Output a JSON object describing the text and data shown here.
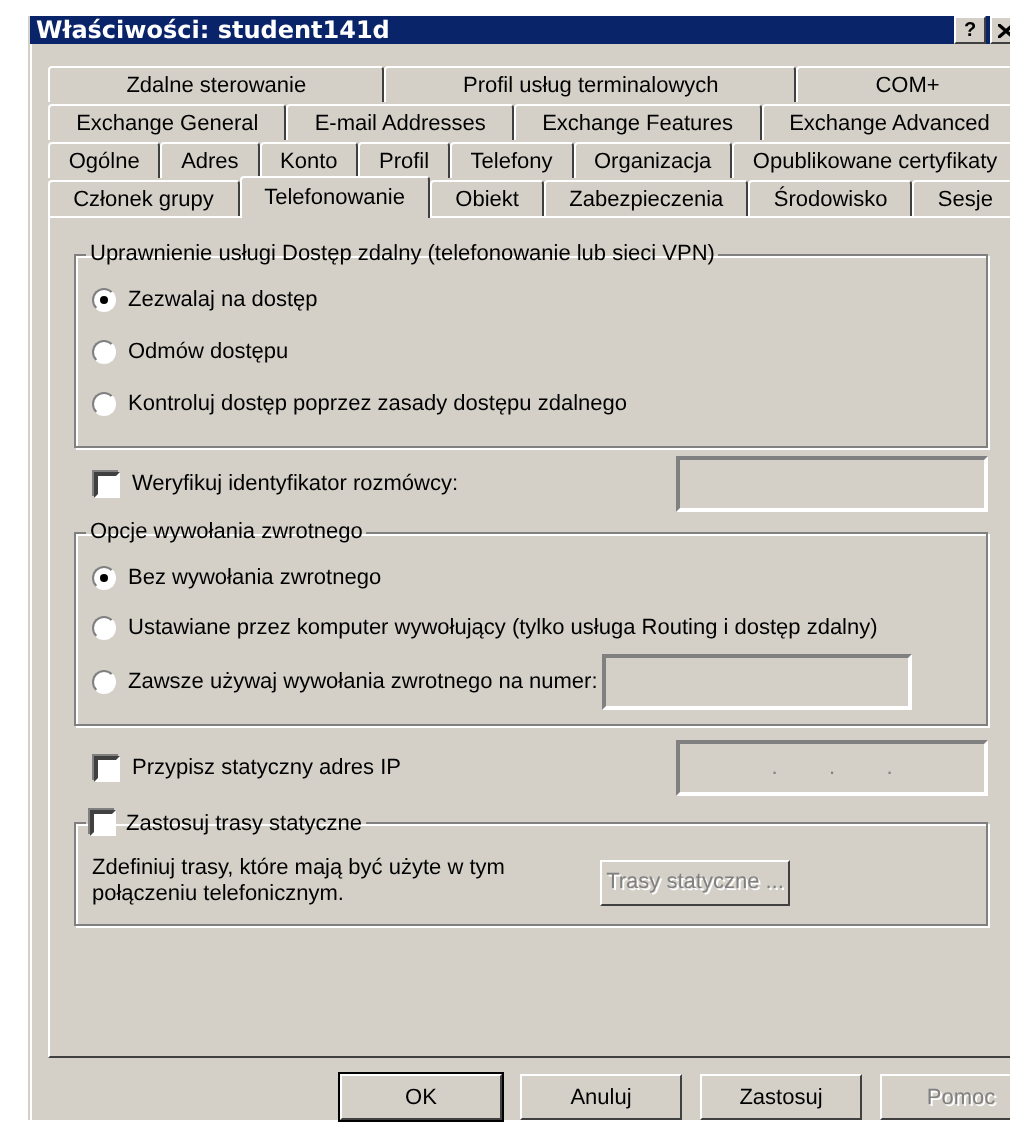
{
  "window": {
    "title": "Właściwości: student141d",
    "help_button": "?"
  },
  "tab_rows": [
    [
      {
        "label": "Zdalne sterowanie",
        "selected": false
      },
      {
        "label": "Profil usług terminalowych",
        "selected": false
      },
      {
        "label": "COM+",
        "selected": false
      }
    ],
    [
      {
        "label": "Exchange General",
        "selected": false
      },
      {
        "label": "E-mail Addresses",
        "selected": false
      },
      {
        "label": "Exchange Features",
        "selected": false
      },
      {
        "label": "Exchange Advanced",
        "selected": false
      }
    ],
    [
      {
        "label": "Ogólne",
        "selected": false
      },
      {
        "label": "Adres",
        "selected": false
      },
      {
        "label": "Konto",
        "selected": false
      },
      {
        "label": "Profil",
        "selected": false
      },
      {
        "label": "Telefony",
        "selected": false
      },
      {
        "label": "Organizacja",
        "selected": false
      },
      {
        "label": "Opublikowane certyfikaty",
        "selected": false
      }
    ],
    [
      {
        "label": "Członek grupy",
        "selected": false
      },
      {
        "label": "Telefonowanie",
        "selected": true
      },
      {
        "label": "Obiekt",
        "selected": false
      },
      {
        "label": "Zabezpieczenia",
        "selected": false
      },
      {
        "label": "Środowisko",
        "selected": false
      },
      {
        "label": "Sesje",
        "selected": false
      }
    ]
  ],
  "remote_access": {
    "title": "Uprawnienie usługi Dostęp zdalny (telefonowanie lub sieci VPN)",
    "options": [
      {
        "label": "Zezwalaj na dostęp",
        "selected": true
      },
      {
        "label": "Odmów dostępu",
        "selected": false
      },
      {
        "label": "Kontroluj dostęp poprzez zasady dostępu zdalnego",
        "selected": false
      }
    ]
  },
  "verify_caller": {
    "label": "Weryfikuj identyfikator rozmówcy:",
    "checked": false,
    "field": {
      "disabled": true
    }
  },
  "callback": {
    "title": "Opcje wywołania zwrotnego",
    "options": [
      {
        "label": "Bez wywołania zwrotnego",
        "selected": true,
        "kind": "plain"
      },
      {
        "label": "Ustawiane przez komputer wywołujący (tylko usługa Routing i dostęp zdalny)",
        "selected": false,
        "kind": "plain"
      },
      {
        "label": "Zawsze używaj wywołania zwrotnego na numer:",
        "selected": false,
        "kind": "with_field",
        "field": {
          "disabled": true
        }
      }
    ]
  },
  "static_ip": {
    "label": "Przypisz statyczny adres IP",
    "checked": false,
    "separators": [
      ".",
      ".",
      "."
    ]
  },
  "static_routes": {
    "label": "Zastosuj trasy statyczne",
    "checked": false,
    "description": "Zdefiniuj trasy, które mają być użyte w tym połączeniu telefonicznym.",
    "button": {
      "label": "Trasy statyczne ...",
      "disabled": true
    }
  },
  "buttons": [
    {
      "label": "OK",
      "default": true,
      "disabled": false
    },
    {
      "label": "Anuluj",
      "default": false,
      "disabled": false
    },
    {
      "label": "Zastosuj",
      "default": false,
      "disabled": false
    },
    {
      "label": "Pomoc",
      "default": false,
      "disabled": true
    }
  ]
}
